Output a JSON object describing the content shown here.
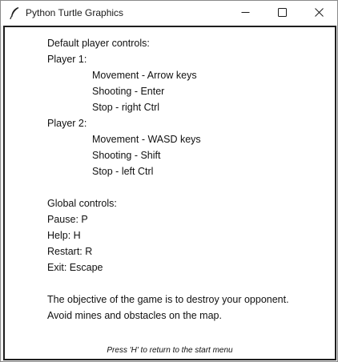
{
  "window": {
    "title": "Python Turtle Graphics",
    "controls": {
      "minimize_icon": "minimize-icon",
      "maximize_icon": "maximize-icon",
      "close_icon": "close-icon"
    }
  },
  "help": {
    "heading": "Default player controls:",
    "player1": {
      "label": "Player 1:",
      "movement": "Movement - Arrow keys",
      "shooting": "Shooting - Enter",
      "stop": "Stop - right Ctrl"
    },
    "player2": {
      "label": "Player 2:",
      "movement": "Movement - WASD keys",
      "shooting": "Shooting - Shift",
      "stop": "Stop - left Ctrl"
    },
    "global": {
      "heading": "Global controls:",
      "pause": "Pause: P",
      "help": "Help: H",
      "restart": "Restart: R",
      "exit": "Exit: Escape"
    },
    "objective_line1": "The objective of the game is to destroy your opponent.",
    "objective_line2": "Avoid mines and obstacles on the map.",
    "footer": "Press 'H' to return to the start menu"
  },
  "colors": {
    "text": "#111111",
    "frame": "#1e1e1e",
    "titlebar": "#ffffff"
  }
}
